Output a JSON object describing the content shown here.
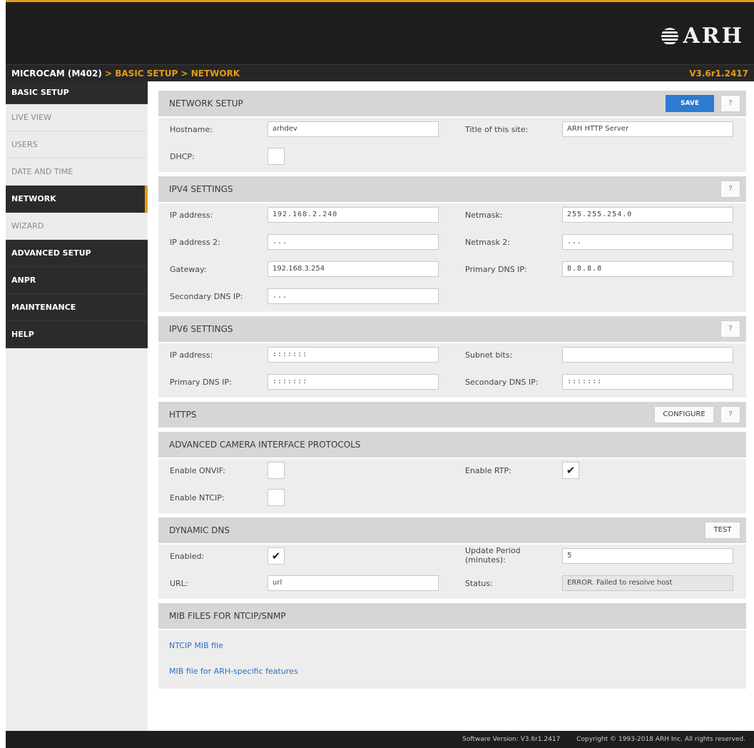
{
  "header": {
    "logo_text": "ARH",
    "breadcrumb": [
      "MICROCAM (M402)",
      " > BASIC SETUP > NETWORK"
    ],
    "version": "V3.6r1.2417"
  },
  "sidebar": {
    "items": [
      {
        "label": "BASIC SETUP"
      },
      {
        "label": "LIVE VIEW"
      },
      {
        "label": "USERS"
      },
      {
        "label": "DATE AND TIME"
      },
      {
        "label": "NETWORK"
      },
      {
        "label": "WIZARD"
      },
      {
        "label": "ADVANCED SETUP"
      },
      {
        "label": "ANPR"
      },
      {
        "label": "MAINTENANCE"
      },
      {
        "label": "HELP"
      }
    ]
  },
  "network_setup": {
    "title": "NETWORK SETUP",
    "save_label": "SAVE",
    "help_label": "?",
    "hostname_label": "Hostname:",
    "hostname_value": "arhdev",
    "site_title_label": "Title of this site:",
    "site_title_value": "ARH HTTP Server",
    "dhcp_label": "DHCP:"
  },
  "ipv4": {
    "title": "IPV4 SETTINGS",
    "help_label": "?",
    "ip_label": "IP address:",
    "ip_value": "192.168.2.240",
    "netmask_label": "Netmask:",
    "netmask_value": "255.255.254.0",
    "ip2_label": "IP address 2:",
    "ip2_value": "...",
    "netmask2_label": "Netmask 2:",
    "netmask2_value": "...",
    "gateway_label": "Gateway:",
    "gateway_value": "192.168.3.254",
    "dns1_label": "Primary DNS IP:",
    "dns1_value": "8.8.8.8",
    "dns2_label": "Secondary DNS IP:",
    "dns2_value": "..."
  },
  "ipv6": {
    "title": "IPV6 SETTINGS",
    "help_label": "?",
    "ip_label": "IP address:",
    "ip_value": ":::::::",
    "subnet_label": "Subnet bits:",
    "subnet_value": "",
    "dns1_label": "Primary DNS IP:",
    "dns1_value": ":::::::",
    "dns2_label": "Secondary DNS IP:",
    "dns2_value": ":::::::"
  },
  "https": {
    "title": "HTTPS",
    "configure_label": "CONFIGURE",
    "help_label": "?"
  },
  "protocols": {
    "title": "ADVANCED CAMERA INTERFACE PROTOCOLS",
    "onvif_label": "Enable ONVIF:",
    "onvif_checked": false,
    "rtp_label": "Enable RTP:",
    "rtp_checked": true,
    "rtp_mark": "✔",
    "ntcip_label": "Enable NTCIP:",
    "ntcip_checked": false
  },
  "ddns": {
    "title": "DYNAMIC DNS",
    "test_label": "TEST",
    "enabled_label": "Enabled:",
    "enabled_checked": true,
    "enabled_mark": "✔",
    "period_label_1": "Update Period",
    "period_label_2": "(minutes):",
    "period_value": "5",
    "url_label": "URL:",
    "url_value": "url",
    "status_label": "Status:",
    "status_value": "ERROR. Failed to resolve host"
  },
  "mib": {
    "title": "MIB FILES FOR NTCIP/SNMP",
    "links": [
      "NTCIP MIB file",
      "MIB file for ARH-specific features"
    ]
  },
  "footer": {
    "software_version": "Software Version:  V3.6r1.2417",
    "copyright": "Copyright © 1993-2018 ARH Inc. All rights reserved."
  }
}
